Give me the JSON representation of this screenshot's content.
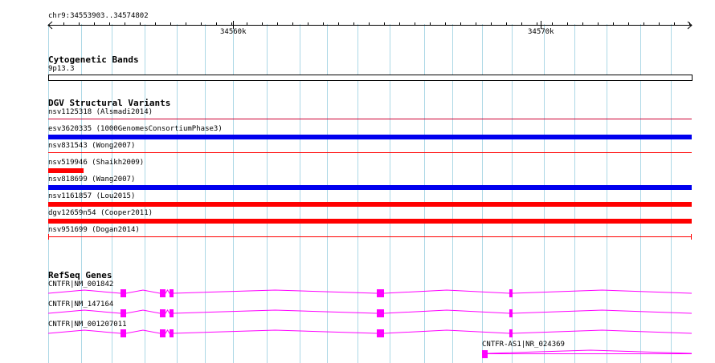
{
  "ruler": {
    "range_label": "chr9:34553903..34574802",
    "ticks": [
      {
        "label": "34560k"
      },
      {
        "label": "34570k"
      }
    ]
  },
  "cytobands": {
    "title": "Cytogenetic Bands",
    "band": "9p13.3"
  },
  "dgv": {
    "title": "DGV Structural Variants",
    "items": [
      {
        "label": "nsv1125318 (Alsmadi2014)",
        "color": "#cc0033",
        "span": [
          0.0,
          1.0
        ]
      },
      {
        "label": "esv3620335 (1000GenomesConsortiumPhase3)",
        "color": "#0000ee",
        "span": [
          0.0,
          1.0
        ]
      },
      {
        "label": "nsv831543 (Wong2007)",
        "color": "#ff0000",
        "span": [
          0.0,
          1.0
        ]
      },
      {
        "label": "nsv519946 (Shaikh2009)",
        "color": "#ff0000",
        "span": [
          0.0,
          0.055
        ]
      },
      {
        "label": "nsv818699 (Wang2007)",
        "color": "#0000ee",
        "span": [
          0.0,
          1.0
        ]
      },
      {
        "label": "nsv1161857 (Lou2015)",
        "color": "#ff0000",
        "span": [
          0.0,
          1.0
        ]
      },
      {
        "label": "dgv12659n54 (Cooper2011)",
        "color": "#ff0000",
        "span": [
          0.0,
          1.0
        ]
      },
      {
        "label": "nsv951699 (Dogan2014)",
        "color": "#ff0000",
        "span": [
          0.0,
          1.0
        ]
      }
    ]
  },
  "refseq": {
    "title": "RefSeq Genes",
    "color": "#ff00ff",
    "genes": [
      {
        "label": "CNTFR|NM_001842"
      },
      {
        "label": "CNTFR|NM_147164"
      },
      {
        "label": "CNTFR|NM_001207011"
      },
      {
        "label": "CNTFR-AS1|NR_024369"
      }
    ]
  },
  "colors": {
    "grid": "#add8e6",
    "axis": "#000000"
  }
}
